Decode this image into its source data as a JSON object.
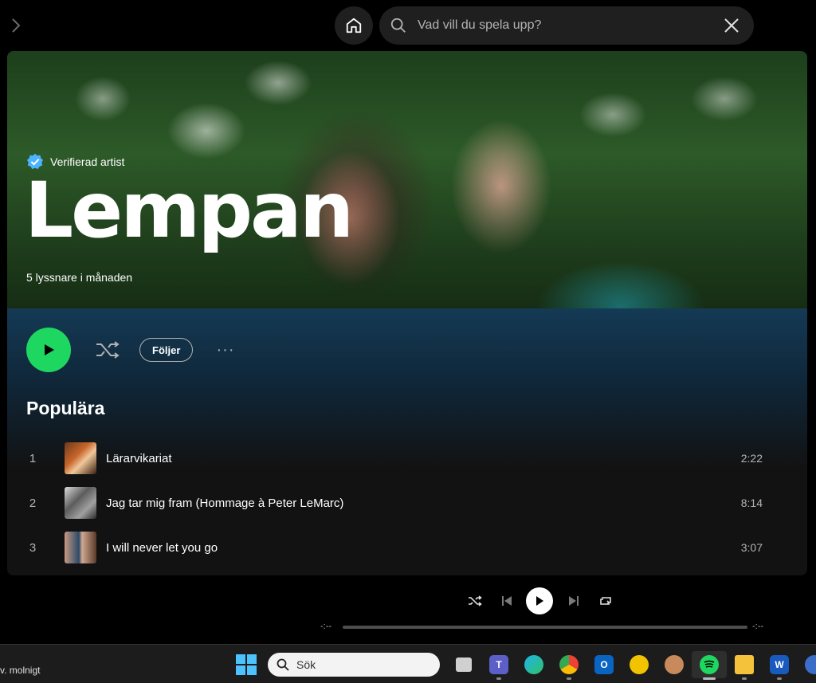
{
  "header": {
    "forward_icon": "chevron-right-icon",
    "home_icon": "home-icon",
    "search_placeholder": "Vad vill du spela upp?",
    "search_value": "",
    "clear_icon": "close-icon"
  },
  "artist": {
    "verified_label": "Verifierad artist",
    "name": "Lempan",
    "listeners": "5 lyssnare i månaden",
    "follow_label": "Följer",
    "more_label": "···"
  },
  "popular": {
    "title": "Populära",
    "tracks": [
      {
        "num": "1",
        "title": "Lärarvikariat",
        "duration": "2:22"
      },
      {
        "num": "2",
        "title": "Jag tar mig fram (Hommage à Peter LeMarc)",
        "duration": "8:14"
      },
      {
        "num": "3",
        "title": "I will never let you go",
        "duration": "3:07"
      }
    ]
  },
  "player": {
    "elapsed": "-:--",
    "remaining": "-:--",
    "progress": 0
  },
  "taskbar": {
    "weather": "v. molnigt",
    "search_label": "Sök",
    "apps": [
      "task-view",
      "teams",
      "edge",
      "chrome",
      "outlook",
      "app",
      "app",
      "spotify",
      "file-explorer",
      "word",
      "app"
    ]
  },
  "colors": {
    "accent": "#1ed760",
    "background": "#121212",
    "hero_gradient": "#143a55"
  }
}
